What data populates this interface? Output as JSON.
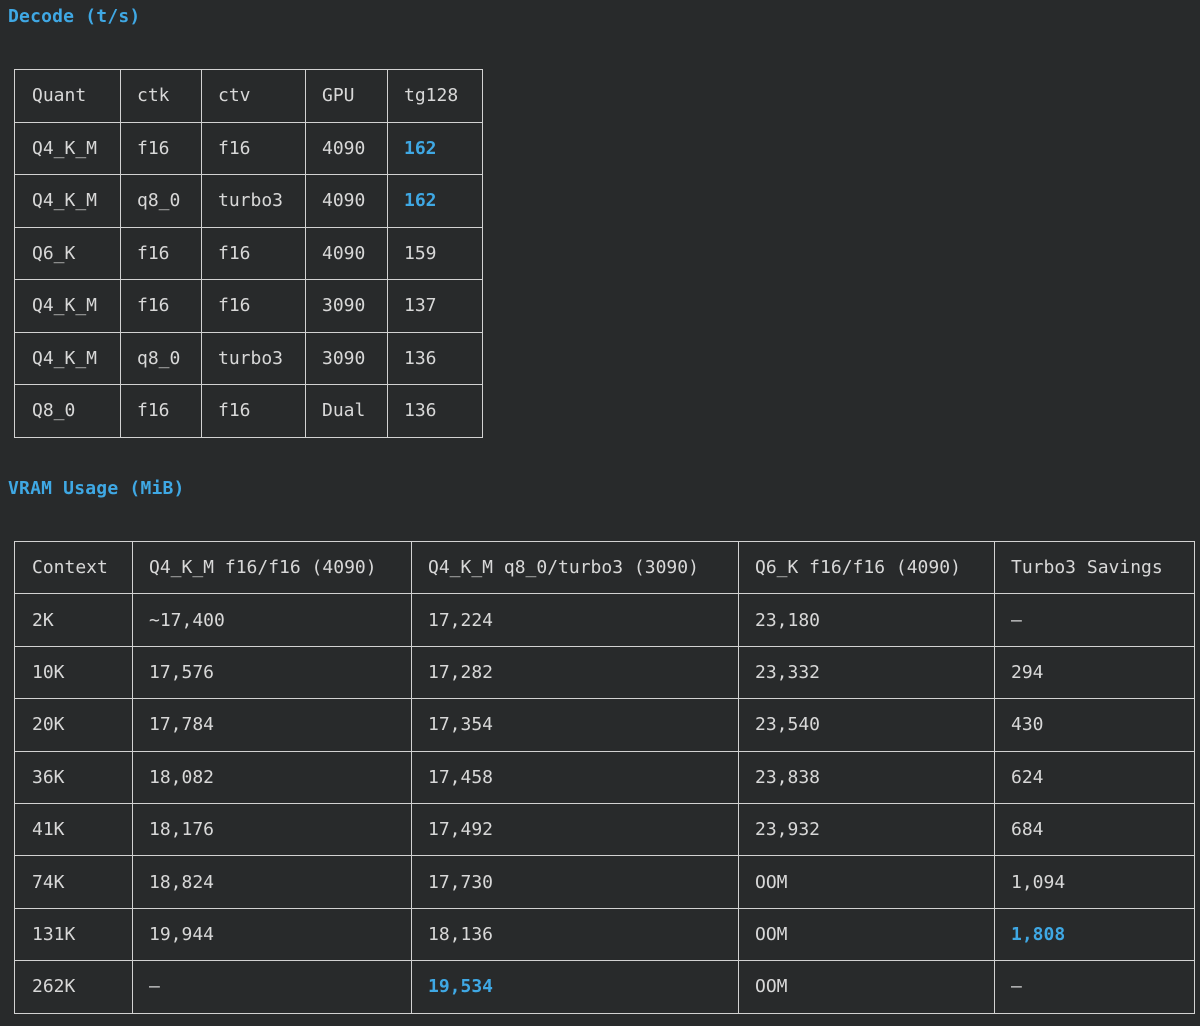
{
  "decode": {
    "title": "Decode (t/s)",
    "headers": [
      "Quant",
      "ctk",
      "ctv",
      "GPU",
      "tg128"
    ],
    "rows": [
      [
        "Q4_K_M",
        "f16",
        "f16",
        "4090",
        "162"
      ],
      [
        "Q4_K_M",
        "q8_0",
        "turbo3",
        "4090",
        "162"
      ],
      [
        "Q6_K",
        "f16",
        "f16",
        "4090",
        "159"
      ],
      [
        "Q4_K_M",
        "f16",
        "f16",
        "3090",
        "137"
      ],
      [
        "Q4_K_M",
        "q8_0",
        "turbo3",
        "3090",
        "136"
      ],
      [
        "Q8_0",
        "f16",
        "f16",
        "Dual",
        "136"
      ]
    ],
    "highlight": [
      [
        0,
        4
      ],
      [
        1,
        4
      ]
    ]
  },
  "vram": {
    "title": "VRAM Usage (MiB)",
    "headers": [
      "Context",
      "Q4_K_M f16/f16 (4090)",
      "Q4_K_M q8_0/turbo3 (3090)",
      "Q6_K f16/f16 (4090)",
      "Turbo3 Savings"
    ],
    "rows": [
      [
        "2K",
        "~17,400",
        "17,224",
        "23,180",
        "—"
      ],
      [
        "10K",
        "17,576",
        "17,282",
        "23,332",
        "294"
      ],
      [
        "20K",
        "17,784",
        "17,354",
        "23,540",
        "430"
      ],
      [
        "36K",
        "18,082",
        "17,458",
        "23,838",
        "624"
      ],
      [
        "41K",
        "18,176",
        "17,492",
        "23,932",
        "684"
      ],
      [
        "74K",
        "18,824",
        "17,730",
        "OOM",
        "1,094"
      ],
      [
        "131K",
        "19,944",
        "18,136",
        "OOM",
        "1,808"
      ],
      [
        "262K",
        "—",
        "19,534",
        "OOM",
        "—"
      ]
    ],
    "highlight": [
      [
        6,
        4
      ],
      [
        7,
        2
      ]
    ]
  },
  "colors": {
    "background": "#282a2b",
    "accent": "#3fa8e4",
    "text": "#d8d8d8",
    "border": "#d2d2d2"
  }
}
